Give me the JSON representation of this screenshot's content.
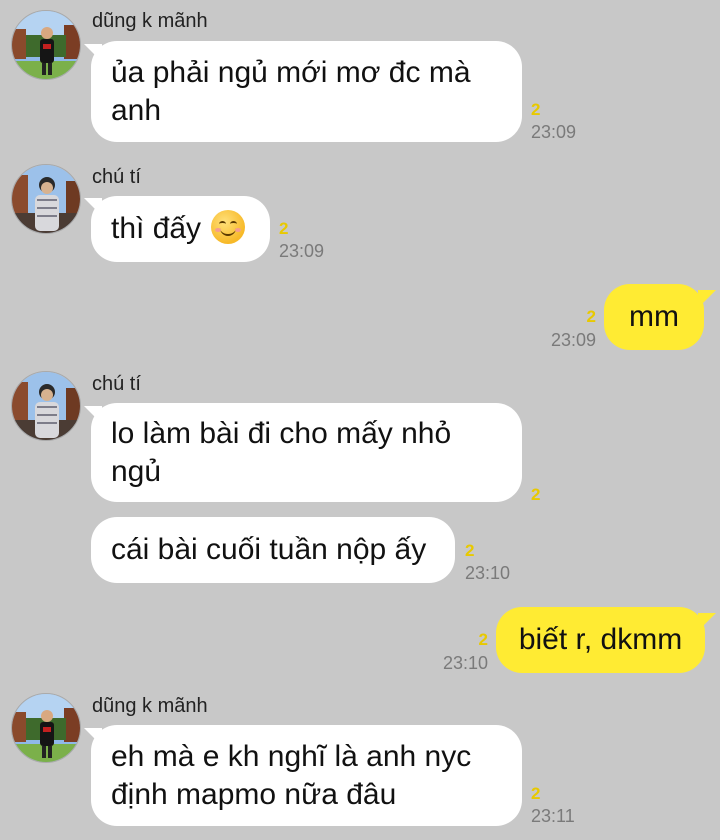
{
  "theme": {
    "background": "#c8c8c8",
    "incoming_bubble": "#ffffff",
    "outgoing_bubble": "#ffeb33",
    "unread_color": "#e8c900"
  },
  "contacts": {
    "dung": {
      "name": "dũng k mãnh",
      "avatar_icon": "profile-photo-icon"
    },
    "chuti": {
      "name": "chú tí",
      "avatar_icon": "profile-photo-icon"
    }
  },
  "messages": [
    {
      "text": "ủa phải ngủ mới mơ đc mà\nanh",
      "unread": "2",
      "time": "23:09"
    },
    {
      "text": "thì đấy",
      "emoji": "smiling-face-emoji",
      "unread": "2",
      "time": "23:09"
    },
    {
      "text": "mm",
      "unread": "2",
      "time": "23:09"
    },
    {
      "text": "lo làm bài đi cho mấy nhỏ\nngủ",
      "unread": "2"
    },
    {
      "text": "cái bài cuối tuần nộp ấy",
      "unread": "2",
      "time": "23:10"
    },
    {
      "text": "biết r, dkmm",
      "unread": "2",
      "time": "23:10"
    },
    {
      "text": "eh mà e kh nghĩ là anh nyc\nđịnh mapmo nữa đâu",
      "unread": "2",
      "time": "23:11"
    }
  ]
}
